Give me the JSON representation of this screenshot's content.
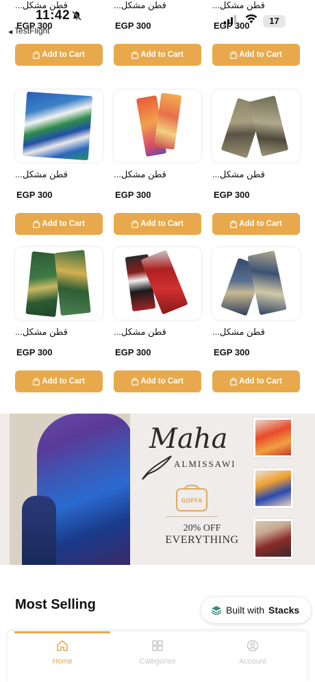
{
  "status_bar": {
    "time": "11:42",
    "back_app": "TestFlight",
    "battery": "17"
  },
  "colors": {
    "accent": "#e8a94c",
    "muted": "#c8c8c8"
  },
  "product_rows": [
    {
      "items": [
        {
          "name": "قطن مشكل...",
          "price": "EGP 300",
          "button": "Add to Cart"
        },
        {
          "name": "قطن مشكل...",
          "price": "EGP 300",
          "button": "Add to Cart"
        },
        {
          "name": "قطن مشكل...",
          "price": "EGP 300",
          "button": "Add to Cart"
        }
      ]
    },
    {
      "items": [
        {
          "name": "قطن مشكل...",
          "price": "EGP 300",
          "button": "Add to Cart"
        },
        {
          "name": "قطن مشكل...",
          "price": "EGP 300",
          "button": "Add to Cart"
        },
        {
          "name": "قطن مشكل...",
          "price": "EGP 300",
          "button": "Add to Cart"
        }
      ]
    },
    {
      "items": [
        {
          "name": "قطن مشكل...",
          "price": "EGP 300",
          "button": "Add to Cart"
        },
        {
          "name": "قطن مشكل...",
          "price": "EGP 300",
          "button": "Add to Cart"
        },
        {
          "name": "قطن مشكل...",
          "price": "EGP 300",
          "button": "Add to Cart"
        }
      ]
    }
  ],
  "banner": {
    "brand": "Maha",
    "brand_sub": "ALMISSAWI",
    "logo_text": "GOFFA",
    "promo_line1": "20% OFF",
    "promo_line2": "EVERYTHING"
  },
  "most_selling": {
    "title": "Most Selling"
  },
  "built_with": {
    "prefix": "Built with",
    "brand": "Stacks"
  },
  "bottom_nav": [
    {
      "label": "Home",
      "icon": "home-icon",
      "active": true
    },
    {
      "label": "Categories",
      "icon": "grid-icon",
      "active": false
    },
    {
      "label": "Account",
      "icon": "user-icon",
      "active": false
    }
  ]
}
